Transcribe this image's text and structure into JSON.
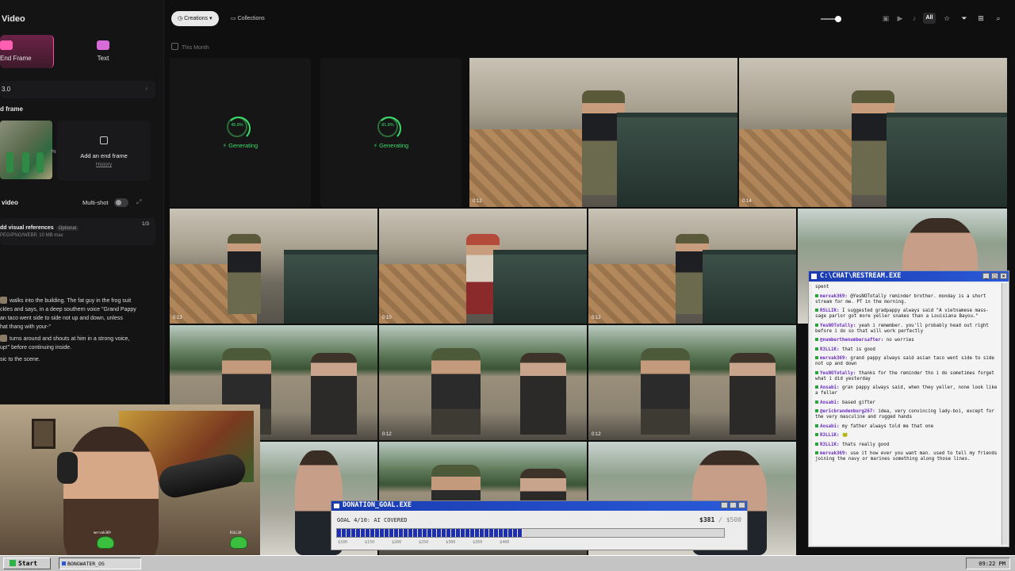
{
  "left_panel": {
    "title": "Video",
    "modes": [
      {
        "label": "End Frame"
      },
      {
        "label": "Text"
      }
    ],
    "model_label": "3.0",
    "end_frame_label": "d frame",
    "add_end_frame": {
      "title": "Add an end frame",
      "link": "History"
    },
    "video_label": "video",
    "multishot_label": "Multi-shot",
    "refs": {
      "title": "dd visual references",
      "optional": "Optional",
      "sub": "PEG/PNG/WEBP, 10 MB max",
      "count": "1/3"
    },
    "prompt_lines": [
      [
        "walks into the building. The fat guy in the frog suit",
        "ckles and says, in a deep southern voice \"Grand Pappy",
        "an taco went side to side not up and down, unless",
        "hat thang with your-\""
      ],
      [
        "turns around and shouts at him in a strong voice,",
        "up!\" before continuing inside."
      ],
      [
        "sic to the scene."
      ]
    ]
  },
  "topbar": {
    "creations": "Creations",
    "collections": "Collections",
    "all": "All",
    "icons": [
      "image-filter-icon",
      "video-filter-icon",
      "audio-filter-icon",
      "star-icon",
      "filter-icon",
      "grid-icon",
      "search-icon"
    ]
  },
  "section_label": "This Month",
  "generating": [
    {
      "pct": "45.8%",
      "status": "Generating"
    },
    {
      "pct": "81.8%",
      "status": "Generating"
    }
  ],
  "durations": [
    "0:12",
    "0:14",
    "0:13",
    "0:10",
    "0:12",
    "0:12",
    "0:12"
  ],
  "chat": {
    "title": "C:\\CHAT\\RESTREAM.EXE",
    "messages": [
      {
        "user": "",
        "text": "spent"
      },
      {
        "user": "mervak369",
        "text": "@YesNOTotally reminder brother. monday is a short stream for me. PT in the morning."
      },
      {
        "user": "RSLLIK",
        "text": "I suggested gradpappy always said \"A vietnamese mass-sage parlor got more yeller snakes than a Louisiana Bayou.\""
      },
      {
        "user": "YesNOTotally",
        "text": "yeah i remember. you'll probably head out right before i do so that will work perfectly"
      },
      {
        "user": "@numberthenumbersafter",
        "text": "no worries"
      },
      {
        "user": "R3LL1K",
        "text": "that is good"
      },
      {
        "user": "mervak369",
        "text": "grand pappy always said asian taco went side to side not up and down"
      },
      {
        "user": "YesNOTotally",
        "text": "thanks for the reminder tho i do sometimes forget what i did yesterday"
      },
      {
        "user": "Aosabi",
        "text": "gran pappy always said, when they yeller, none look like a feller"
      },
      {
        "user": "Aosabi",
        "text": "based gifter"
      },
      {
        "user": "@ericbrandenburg267",
        "text": "idea, very convincing lady-boi, except for the very masculine and rugged hands"
      },
      {
        "user": "Aosabi",
        "text": "my father always told me that one"
      },
      {
        "user": "R3LL1K",
        "text": "🐸"
      },
      {
        "user": "R3LL1K",
        "text": "thats really good"
      },
      {
        "user": "mervak369",
        "text": "use it how ever you want man. used to tell my friends joining the navy or marines something along those lines."
      }
    ]
  },
  "donation": {
    "title": "DONATION_GOAL.EXE",
    "goal_text": "GOAL 4/10: AI COVERED",
    "current": "$381",
    "max": "/ $500",
    "progress": 0.48,
    "ticks": [
      "$100",
      "$150",
      "$200",
      "$250",
      "$300",
      "$350",
      "$400"
    ]
  },
  "webcam": {
    "chat_names": [
      "mervak369",
      "R3LL1K",
      "R3LL1K"
    ]
  },
  "taskbar": {
    "start": "Start",
    "window": "BONGWATER_OS",
    "clock": "09:22 PM"
  }
}
